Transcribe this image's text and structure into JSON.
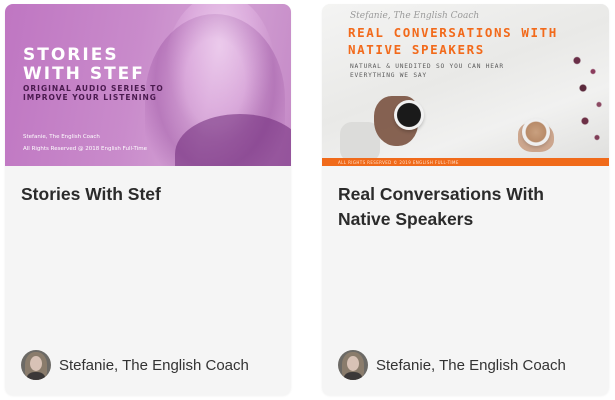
{
  "cards": [
    {
      "title": "Stories With Stef",
      "thumbnail": {
        "heading_line1": "STORIES",
        "heading_line2": "WITH STEF",
        "subheading_line1": "ORIGINAL AUDIO SERIES TO",
        "subheading_line2": "IMPROVE YOUR LISTENING",
        "credit": "Stefanie, The English Coach",
        "rights": "All Rights Reserved @ 2018 English Full-Time",
        "tint_color": "#c98bcb"
      },
      "author": {
        "name": "Stefanie, The English Coach",
        "avatar_icon": "profile-photo"
      }
    },
    {
      "title": "Real Conversations With Native Speakers",
      "thumbnail": {
        "script_text": "Stefanie, The English Coach",
        "heading_line1": "REAL CONVERSATIONS WITH",
        "heading_line2": "NATIVE SPEAKERS",
        "tagline_line1": "NATURAL & UNEDITED SO YOU CAN HEAR",
        "tagline_line2": "EVERYTHING WE SAY",
        "footer": "ALL RIGHTS RESERVED © 2019 ENGLISH FULL-TIME",
        "accent_color": "#f26a1b"
      },
      "author": {
        "name": "Stefanie, The English Coach",
        "avatar_icon": "profile-photo"
      }
    }
  ],
  "colors": {
    "card_background": "#f5f5f5",
    "title_text": "#2b2b2b",
    "author_text": "#333333"
  }
}
